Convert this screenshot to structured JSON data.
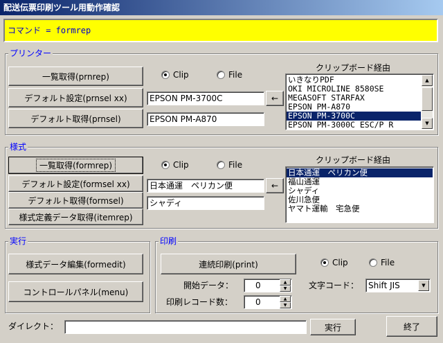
{
  "window": {
    "title": "配送伝票印刷ツール用動作確認"
  },
  "command": {
    "text": "コマンド = formrep"
  },
  "printer": {
    "title": "プリンター",
    "list_button": "一覧取得(prnrep)",
    "set_default_button": "デフォルト設定(prnsel xx)",
    "get_default_button": "デフォルト取得(prnsel)",
    "radio_clip": "Clip",
    "radio_file": "File",
    "selected_mode": "Clip",
    "set_value": "EPSON PM-3700C",
    "arrow": "←",
    "default_value": "EPSON PM-A870",
    "clipboard_label": "クリップボード経由",
    "items": [
      "いきなりPDF",
      "OKI MICROLINE 8580SE",
      "MEGASOFT STARFAX",
      "EPSON PM-A870",
      "EPSON PM-3700C",
      "EPSON PM-3000C ESC/P R"
    ],
    "selected_index": 4
  },
  "form": {
    "title": "様式",
    "list_button": "一覧取得(formrep)",
    "set_default_button": "デフォルト設定(formsel xx)",
    "get_default_button": "デフォルト取得(formsel)",
    "definition_button": "様式定義データ取得(itemrep)",
    "radio_clip": "Clip",
    "radio_file": "File",
    "selected_mode": "Clip",
    "set_value": "日本通運　ペリカン便",
    "arrow": "←",
    "default_value": "シャディ",
    "clipboard_label": "クリップボード経由",
    "items": [
      "日本通運　ペリカン便",
      "福山通運",
      "シャディ",
      "佐川急便",
      "ヤマト運輸　宅急便"
    ],
    "selected_index": 0
  },
  "run": {
    "title": "実行",
    "edit_button": "様式データ編集(formedit)",
    "panel_button": "コントロールパネル(menu)"
  },
  "print": {
    "title": "印刷",
    "continuous_button": "連続印刷(print)",
    "radio_clip": "Clip",
    "radio_file": "File",
    "selected_mode": "Clip",
    "start_label": "開始データ：",
    "start_value": "0",
    "count_label": "印刷レコード数：",
    "count_value": "0",
    "charset_label": "文字コード：",
    "charset_value": "Shift JIS"
  },
  "direct": {
    "label": "ダイレクト：",
    "value": "",
    "run_button": "実行",
    "exit_button": "終了"
  },
  "colors": {
    "titlebar": "#0a246a",
    "command_bg": "#ffff00",
    "group_title": "#0000ff",
    "selection": "#0a246a"
  }
}
